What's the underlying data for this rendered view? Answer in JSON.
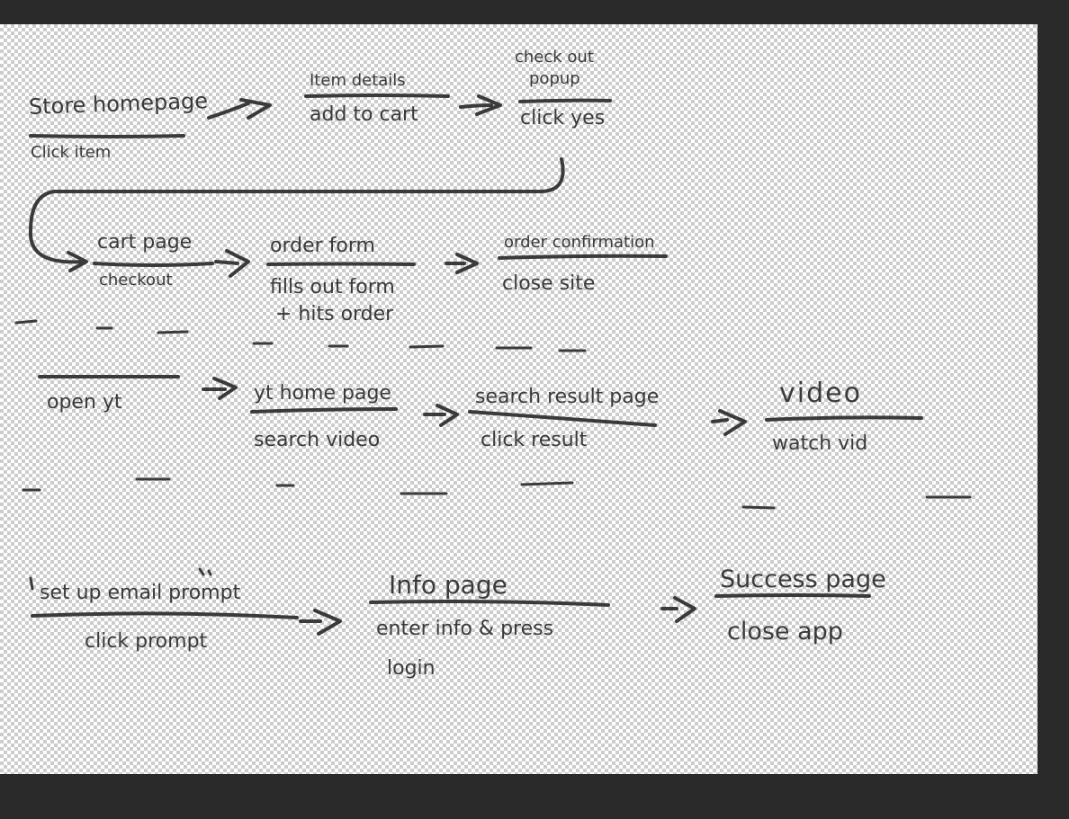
{
  "flows": [
    {
      "steps": [
        {
          "screen": "Store homepage",
          "action": "Click item"
        },
        {
          "screen": "Item details",
          "action": "add to cart"
        },
        {
          "screen": "check out",
          "screen_line2": "popup",
          "action": "click yes"
        },
        {
          "screen": "cart page",
          "action": "checkout"
        },
        {
          "screen": "order form",
          "action": "fills out form",
          "action_line2": "+ hits order"
        },
        {
          "screen": "order confirmation",
          "action": "close site"
        }
      ]
    },
    {
      "steps": [
        {
          "screen": "",
          "action": "open yt"
        },
        {
          "screen": "yt home page",
          "action": "search video"
        },
        {
          "screen": "search result page",
          "action": "click result"
        },
        {
          "screen": "video",
          "action": "watch vid"
        }
      ]
    },
    {
      "steps": [
        {
          "screen": "set up email prompt",
          "action": "click prompt"
        },
        {
          "screen": "Info page",
          "action": "enter info & press",
          "action_line2": "login"
        },
        {
          "screen": "Success page",
          "action": "close app"
        }
      ]
    }
  ]
}
